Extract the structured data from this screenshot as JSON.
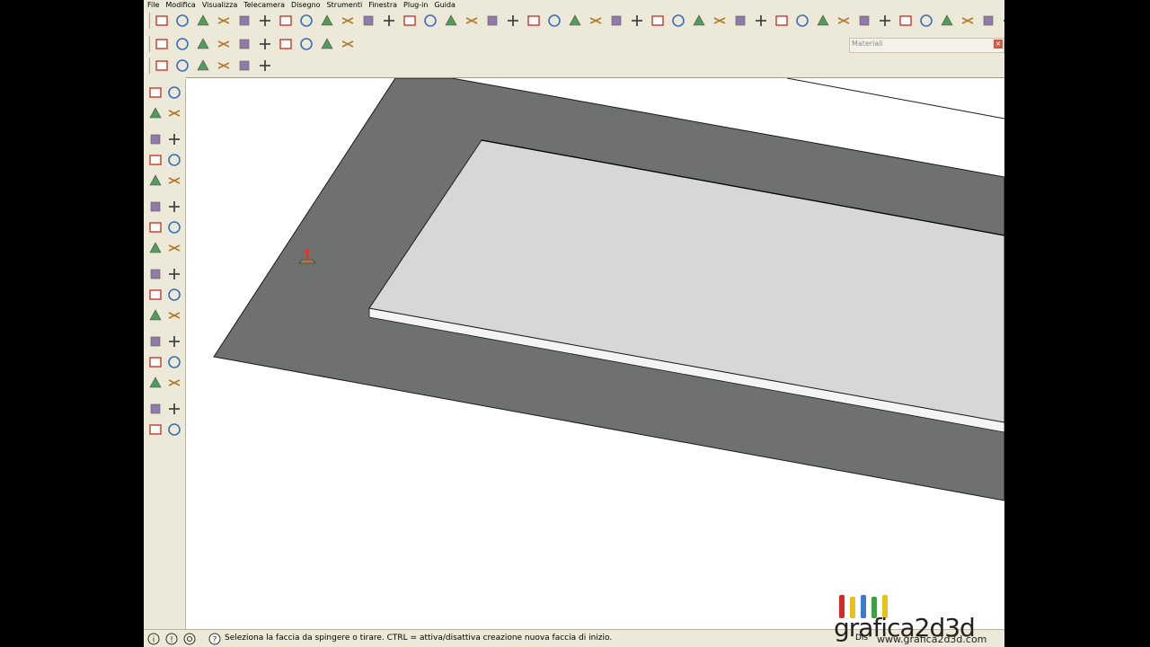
{
  "menu": [
    "File",
    "Modifica",
    "Visualizza",
    "Telecamera",
    "Disegno",
    "Strumenti",
    "Finestra",
    "Plug-in",
    "Guida"
  ],
  "toolbar_row1_icons": [
    "select-icon",
    "line-icon",
    "arc-icon",
    "eraser-icon",
    "rectangle-icon",
    "circle-icon",
    "polygon-icon",
    "freehand-icon",
    "push-pull-icon",
    "move-icon",
    "rotate-icon",
    "scale-icon",
    "offset-icon",
    "tape-measure-icon",
    "protractor-icon",
    "dimension-icon",
    "text-icon",
    "axes-icon",
    "3d-text-icon",
    "section-plane-icon",
    "orbit-icon",
    "pan-icon",
    "zoom-icon",
    "zoom-window-icon",
    "zoom-extents-icon",
    "previous-view-icon",
    "next-view-icon",
    "iso-view-icon",
    "top-view-icon",
    "front-view-icon",
    "right-view-icon",
    "back-view-icon",
    "left-view-icon",
    "x-ray-icon",
    "wireframe-icon",
    "hidden-line-icon",
    "shaded-icon",
    "shaded-texture-icon",
    "monochrome-icon",
    "shadow-icon",
    "fog-icon",
    "edge-icon",
    "profile-icon",
    "sandbox-icon"
  ],
  "toolbar_row2_icons": [
    "materials-m-icon",
    "paint-tag-icon",
    "round-r-icon",
    "help-icon",
    "tag-icon",
    "sun-icon",
    "sandbox-smoove-icon",
    "stamp-icon",
    "drape-icon",
    "flip-edge-icon"
  ],
  "toolbar_row3_icons": [
    "house-3d-icon",
    "door-icon",
    "house-icon",
    "floor-icon",
    "house-outline-icon",
    "window-icon"
  ],
  "materials_panel": {
    "title": "Materiali",
    "close": "×"
  },
  "sidebar_icons": [
    [
      "select-icon",
      "component-icon"
    ],
    [
      "paint-bucket-icon",
      "eraser-icon"
    ],
    [
      "rectangle-icon",
      "line-icon"
    ],
    [
      "circle-icon",
      "arc-icon"
    ],
    [
      "polygon-icon",
      "freehand-icon"
    ],
    [
      "move-icon",
      "push-pull-icon"
    ],
    [
      "rotate-icon",
      "follow-me-icon"
    ],
    [
      "scale-icon",
      "offset-icon"
    ],
    [
      "tape-measure-icon",
      "dimension-icon"
    ],
    [
      "protractor-icon",
      "text-icon"
    ],
    [
      "axes-icon",
      "3d-text-icon"
    ],
    [
      "orbit-icon",
      "pan-icon"
    ],
    [
      "zoom-icon",
      "zoom-window-icon"
    ],
    [
      "zoom-extents-icon",
      "previous-icon"
    ],
    [
      "position-camera-icon",
      "look-around-icon"
    ],
    [
      "walk-icon",
      "section-plane-icon"
    ]
  ],
  "status": {
    "hint": "Seleziona la faccia da spingere o tirare.  CTRL = attiva/disattiva creazione nuova faccia di inizio.",
    "right_label": "Dis"
  },
  "watermark": {
    "logo": "grafica2d3d",
    "url": "www.grafica2d3d.com"
  },
  "colors": {
    "ground": "#6f7070",
    "slab_top": "#d7d7d7",
    "slab_side": "#f4f4f4",
    "edge": "#1a1a1a"
  }
}
